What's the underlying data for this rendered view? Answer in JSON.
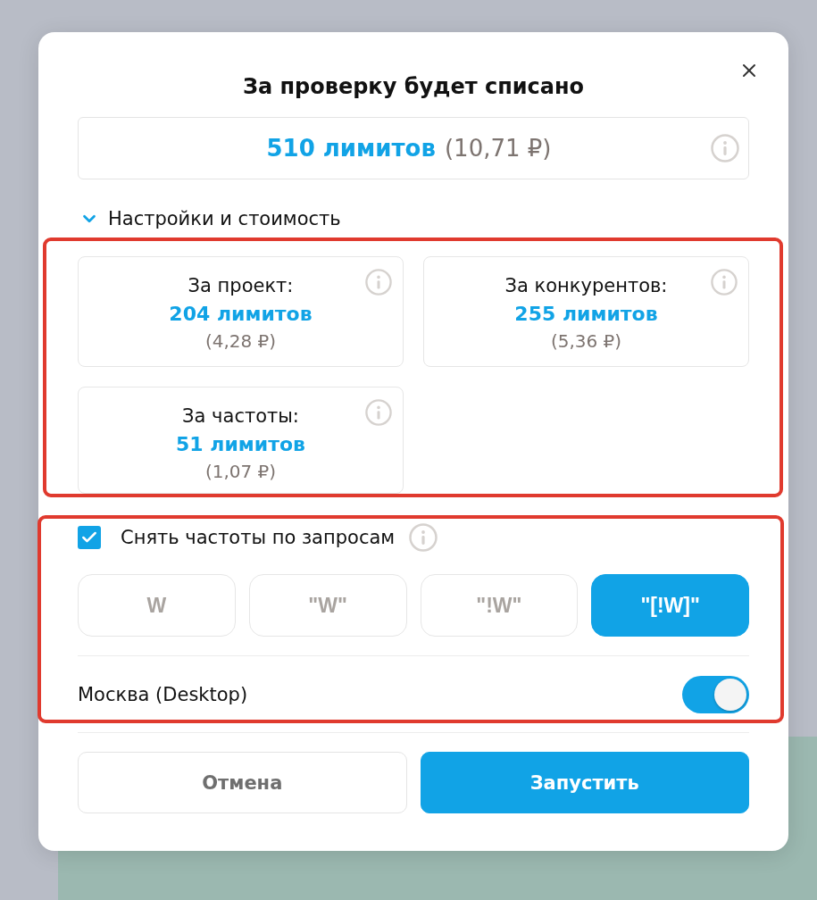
{
  "dialog": {
    "title": "За проверку будет списано"
  },
  "total": {
    "limits": "510 лимитов",
    "price": "(10,71 ₽)"
  },
  "settings": {
    "label": "Настройки и стоимость",
    "expanded": true
  },
  "cost_cards": [
    {
      "label": "За проект:",
      "limits": "204 лимитов",
      "price": "(4,28 ₽)"
    },
    {
      "label": "За конкурентов:",
      "limits": "255 лимитов",
      "price": "(5,36 ₽)"
    },
    {
      "label": "За частоты:",
      "limits": "51 лимитов",
      "price": "(1,07 ₽)"
    }
  ],
  "frequency": {
    "label": "Снять частоты по запросам",
    "checked": true
  },
  "match_types": [
    {
      "label": "W",
      "selected": false
    },
    {
      "label": "\"W\"",
      "selected": false
    },
    {
      "label": "\"!W\"",
      "selected": false
    },
    {
      "label": "\"[!W]\"",
      "selected": true
    }
  ],
  "region": {
    "label": "Москва (Desktop)",
    "on": true
  },
  "buttons": [
    {
      "label": "Отмена",
      "kind": "secondary"
    },
    {
      "label": "Запустить",
      "kind": "primary"
    }
  ]
}
